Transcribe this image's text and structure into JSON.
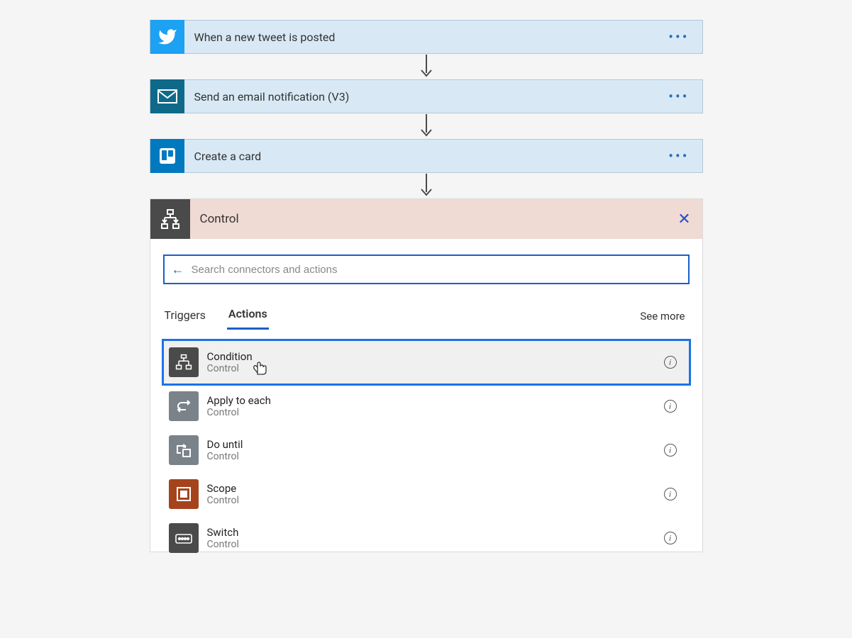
{
  "steps": [
    {
      "title": "When a new tweet is posted",
      "icon": "twitter"
    },
    {
      "title": "Send an email notification (V3)",
      "icon": "mail"
    },
    {
      "title": "Create a card",
      "icon": "trello"
    }
  ],
  "panel": {
    "title": "Control",
    "search_placeholder": "Search connectors and actions",
    "tabs": {
      "triggers": "Triggers",
      "actions": "Actions"
    },
    "see_more": "See more",
    "actions": [
      {
        "name": "Condition",
        "sub": "Control",
        "icon": "condition",
        "highlighted": true
      },
      {
        "name": "Apply to each",
        "sub": "Control",
        "icon": "apply"
      },
      {
        "name": "Do until",
        "sub": "Control",
        "icon": "dountil"
      },
      {
        "name": "Scope",
        "sub": "Control",
        "icon": "scope"
      },
      {
        "name": "Switch",
        "sub": "Control",
        "icon": "switch"
      }
    ]
  }
}
